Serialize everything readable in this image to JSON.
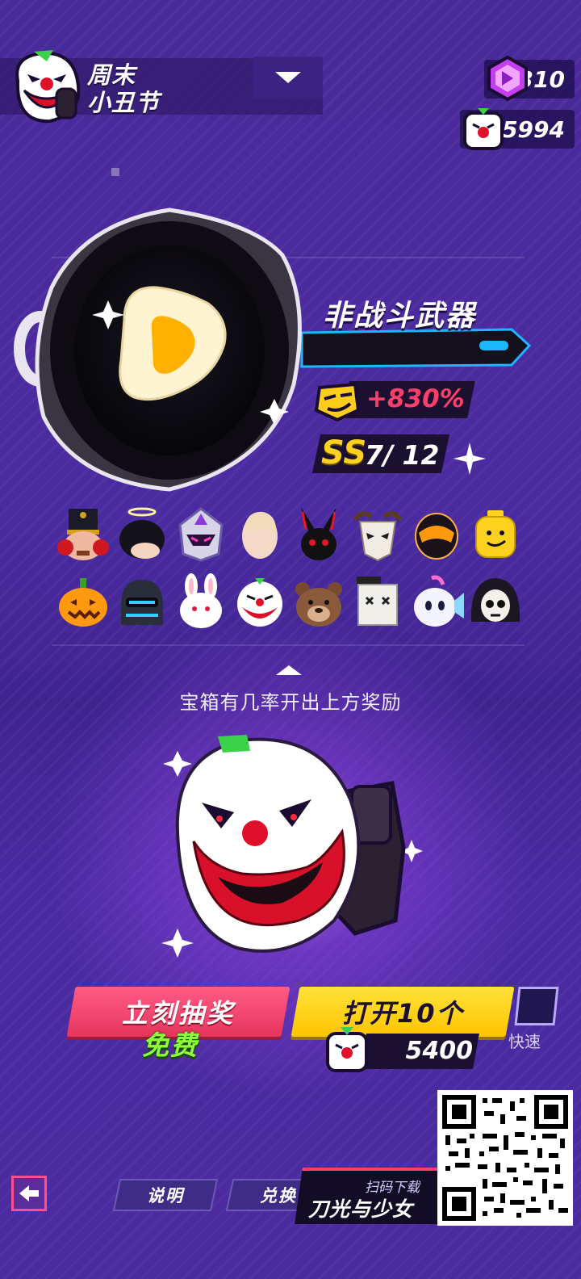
{
  "event": {
    "title_line1": "周末",
    "title_line2": "小丑节"
  },
  "currency": {
    "gems": "310",
    "clown_tokens": "5994",
    "gem_color": "#c23ef0"
  },
  "reward": {
    "category": "非战斗武器",
    "bonus": "+830%",
    "rank_grade": "SS",
    "rank_count": "7/ 12"
  },
  "reward_icons": [
    "nutcracker-hat-icon",
    "black-hair-halo-icon",
    "mech-helmet-icon",
    "blonde-hair-icon",
    "black-bunny-icon",
    "horned-skull-icon",
    "visor-helmet-icon",
    "lego-head-icon",
    "pumpkin-icon",
    "robot-knight-icon",
    "white-bunny-icon",
    "clown-head-icon",
    "bear-head-icon",
    "box-head-icon",
    "fish-head-icon",
    "skull-hood-icon"
  ],
  "hint": "宝箱有几率开出上方奖励",
  "actions": {
    "draw_now": "立刻抽奖",
    "free": "免费",
    "open_ten": "打开10个",
    "open_ten_cost": "5400",
    "quick": "快速"
  },
  "bottom": {
    "help": "说明",
    "redeem": "兑换",
    "promo_sub": "扫码下载",
    "promo_title": "刀光与少女"
  }
}
